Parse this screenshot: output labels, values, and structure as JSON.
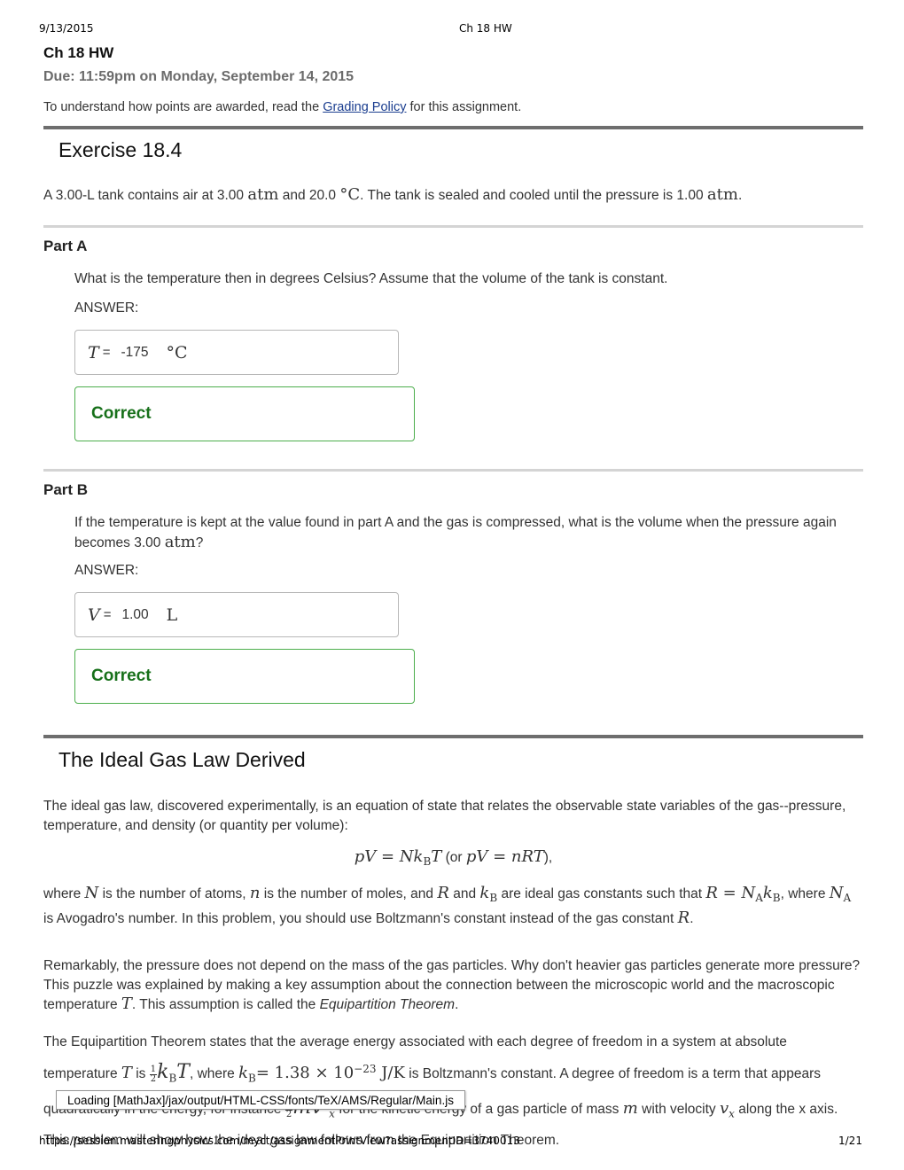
{
  "print_header": {
    "date": "9/13/2015",
    "title": "Ch 18 HW"
  },
  "assignment": {
    "title": "Ch 18 HW",
    "due": "Due: 11:59pm on Monday, September 14, 2015",
    "policy_before": "To understand how points are awarded, read the ",
    "policy_link": "Grading Policy",
    "policy_after": " for this assignment."
  },
  "exercise": {
    "title": "Exercise 18.4",
    "intro": {
      "t1": "A 3.00-L tank contains air at 3.00 ",
      "atm1": "atm",
      "t2": " and 20.0 ",
      "degC": "°C",
      "t3": ". The tank is sealed and cooled until the pressure is 1.00 ",
      "atm2": "atm",
      "t4": "."
    },
    "parts": [
      {
        "title": "Part A",
        "question": "What is the temperature then in degrees Celsius? Assume that the volume of the tank is constant.",
        "answer_label": "ANSWER:",
        "variable": "T",
        "equals": "=",
        "value": "-175",
        "unit": "°C",
        "result": "Correct"
      },
      {
        "title": "Part B",
        "question_before": "If the temperature is kept at the value found in part A and the gas is compressed, what is the volume when the pressure again becomes 3.00 ",
        "question_unit": "atm",
        "question_after": "?",
        "answer_label": "ANSWER:",
        "variable": "V",
        "equals": "=",
        "value": "1.00",
        "unit": "L",
        "result": "Correct"
      }
    ]
  },
  "ideal_gas": {
    "title": "The Ideal Gas Law Derived",
    "p1": "The ideal gas law, discovered experimentally, is an equation of state that relates the observable state variables of the gas--pressure, temperature, and density (or quantity per volume):",
    "equation": {
      "lhs": "pV = Nk",
      "sub": "B",
      "rhs": "T",
      "mid": " (or ",
      "alt": "pV = nRT",
      "end": "),"
    },
    "p2": {
      "a": "where ",
      "N": "N",
      "b": " is the number of atoms, ",
      "n": "n",
      "c": " is the number of moles, and ",
      "R": "R",
      "d": " and ",
      "kB": "k",
      "B": "B",
      "e": " are ideal gas constants such that ",
      "eq": "R = N",
      "A": "A",
      "k": "k",
      "f": ", where ",
      "NA": "N",
      "g": " is Avogadro's number. In this problem, you should use Boltzmann's constant instead of the gas constant ",
      "R2": "R",
      "h": "."
    },
    "p3": {
      "a": "Remarkably, the pressure does not depend on the mass of the gas particles. Why don't heavier gas particles generate more pressure? This puzzle was explained by making a key assumption about the connection between the microscopic world and the macroscopic temperature ",
      "T": "T",
      "b": ". This assumption is called the ",
      "theorem": "Equipartition Theorem",
      "c": "."
    },
    "p4": {
      "a": "The Equipartition Theorem states that the average energy associated with each degree of freedom in a system at absolute temperature ",
      "T": "T",
      "is": " is ",
      "num": "1",
      "den": "2",
      "k": "k",
      "B": "B",
      "T2": "T",
      "b": ", where ",
      "kb_eq": "= 1.38 × 10",
      "exp": "−23",
      "unit": " J/K",
      "c": " is Boltzmann's constant. A degree of freedom is a term that appears quadratically in the energy, for instance ",
      "mv": "mv",
      "sq": "2",
      "x": "x",
      "d": " for the kinetic energy of a gas particle of mass ",
      "m": "m",
      "e": " with velocity ",
      "v": "v",
      "vx": "x",
      "f": " along the x axis. This problem will show how the ideal gas law follows from the Equipartition Theorem."
    }
  },
  "mathjax_status": "Loading [MathJax]/jax/output/HTML-CSS/fonts/TeX/AMS/Regular/Main.js",
  "print_footer": {
    "url": "https://session.masteringphysics.com/myct/assignmentPrintView?assignmentID=3740013",
    "page": "1/21"
  }
}
